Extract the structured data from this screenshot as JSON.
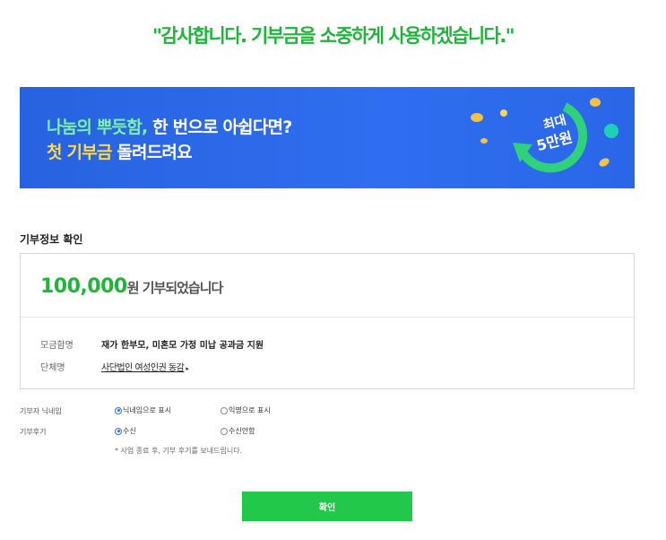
{
  "headline": "\"감사합니다. 기부금을 소중하게 사용하겠습니다.\"",
  "banner": {
    "line1_highlight": "나눔의 뿌듯함,",
    "line1_rest": " 한 번으로 아쉽다면?",
    "line2_highlight": "첫 기부금",
    "line2_rest": " 돌려드려요",
    "badge_line1": "최대",
    "badge_line2": "5만원",
    "colors": {
      "background": "#2f6ef0",
      "highlight_green": "#7cf0a8",
      "highlight_yellow": "#ffd84a"
    }
  },
  "section_title": "기부정보 확인",
  "donation": {
    "amount": "100,000",
    "amount_suffix": "원 기부되었습니다",
    "fundraiser_label": "모금함명",
    "fundraiser_value": "재가 한부모, 미혼모 가정 미납 공과금 지원",
    "org_label": "단체명",
    "org_value": "사단법인 여성인권 동감",
    "org_caret": "▸"
  },
  "options": {
    "nickname_label": "기부자 닉네임",
    "nickname_options": [
      {
        "label": "닉네임으로 표시",
        "selected": true
      },
      {
        "label": "익명으로 표시",
        "selected": false
      }
    ],
    "review_label": "기부후기",
    "review_options": [
      {
        "label": "수신",
        "selected": true
      },
      {
        "label": "수신안함",
        "selected": false
      }
    ],
    "review_note": "* 사업 종료 후, 기부 후기를 보내드립니다."
  },
  "confirm_button": "확인",
  "accent_color": "#21c84a"
}
